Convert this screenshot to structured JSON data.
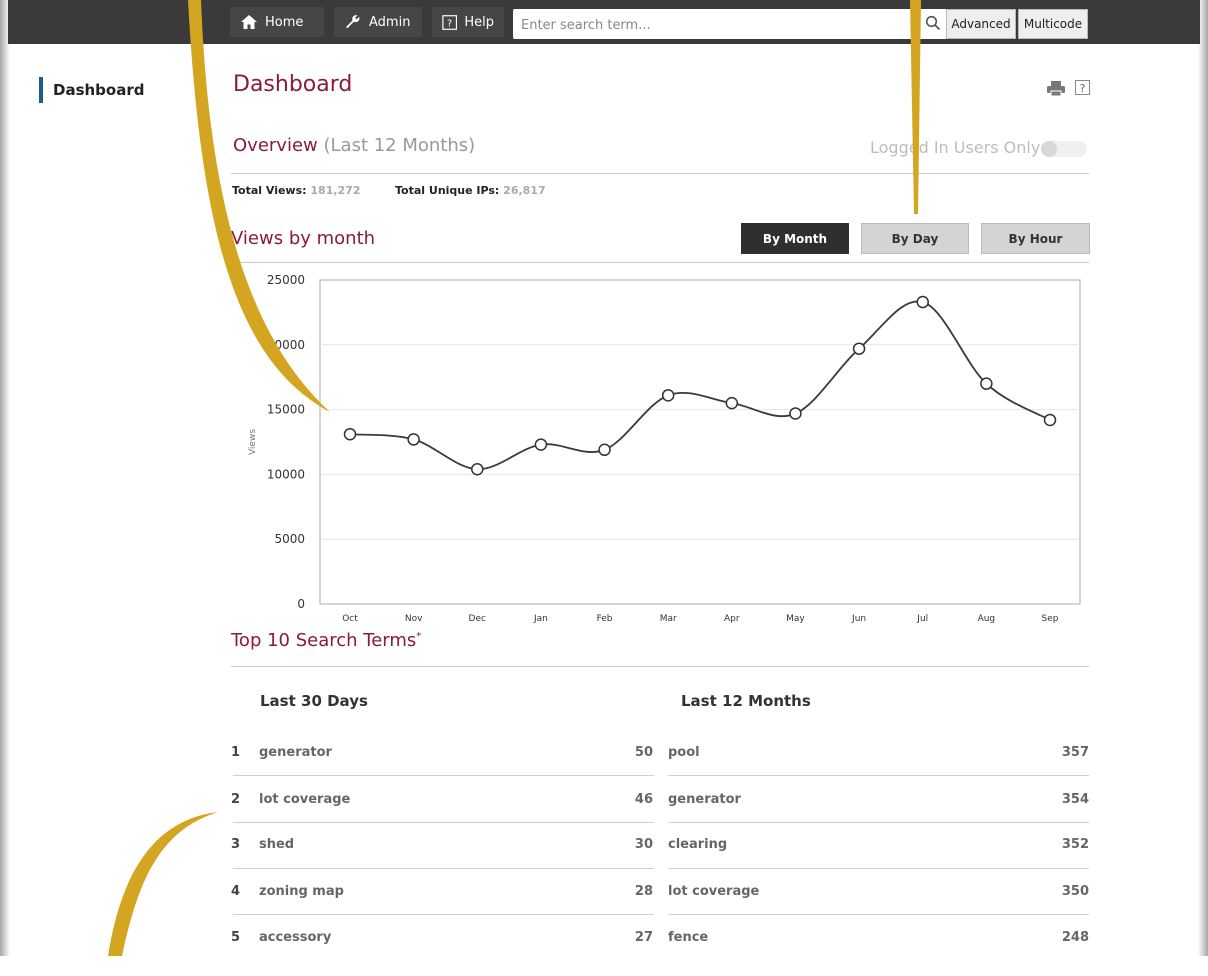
{
  "nav": {
    "home_label": "Home",
    "admin_label": "Admin",
    "help_label": "Help",
    "search_placeholder": "Enter search term...",
    "advanced_label": "Advanced",
    "multicode_label": "Multicode"
  },
  "sidebar": {
    "items": [
      {
        "label": "Dashboard"
      }
    ]
  },
  "page": {
    "title": "Dashboard",
    "overview_title": "Overview",
    "overview_sub": "(Last 12 Months)",
    "toggle_label": "Logged In Users Only",
    "toggle_on": false,
    "total_views_label": "Total Views:",
    "total_views_value": "181,272",
    "unique_ips_label": "Total Unique IPs:",
    "unique_ips_value": "26,817",
    "views_title": "Views by month",
    "tabs": [
      {
        "label": "By Month",
        "active": true
      },
      {
        "label": "By Day",
        "active": false
      },
      {
        "label": "By Hour",
        "active": false
      }
    ]
  },
  "chart_data": {
    "type": "line",
    "categories": [
      "Oct",
      "Nov",
      "Dec",
      "Jan",
      "Feb",
      "Mar",
      "Apr",
      "May",
      "Jun",
      "Jul",
      "Aug",
      "Sep"
    ],
    "values": [
      13100,
      12700,
      10400,
      12300,
      11900,
      16100,
      15500,
      14700,
      19700,
      23300,
      17000,
      14200
    ],
    "ylabel": "Views",
    "ylim": [
      0,
      25000
    ],
    "yticks": [
      "0",
      "5000",
      "10000",
      "15000",
      "20000",
      "25000"
    ],
    "grid": true,
    "line_color": "#3a3a3a"
  },
  "search_terms": {
    "title": "Top 10 Search Terms",
    "title_mark": "*",
    "left_heading": "Last 30 Days",
    "right_heading": "Last 12 Months",
    "rows": [
      {
        "rank": "1",
        "term30": "generator",
        "count30": "50",
        "term12": "pool",
        "count12": "357"
      },
      {
        "rank": "2",
        "term30": "lot coverage",
        "count30": "46",
        "term12": "generator",
        "count12": "354"
      },
      {
        "rank": "3",
        "term30": "shed",
        "count30": "30",
        "term12": "clearing",
        "count12": "352"
      },
      {
        "rank": "4",
        "term30": "zoning map",
        "count30": "28",
        "term12": "lot coverage",
        "count12": "350"
      },
      {
        "rank": "5",
        "term30": "accessory",
        "count30": "27",
        "term12": "fence",
        "count12": "248"
      }
    ]
  },
  "colors": {
    "accent": "#8b1a3c",
    "sidebar_marker": "#1f5a8c",
    "topbar": "#3a3a3a",
    "ribbon": "#d4a520"
  },
  "icons": {
    "home": "home-icon",
    "admin": "wrench-icon",
    "help": "help-icon",
    "search": "search-icon",
    "print": "printer-icon"
  }
}
